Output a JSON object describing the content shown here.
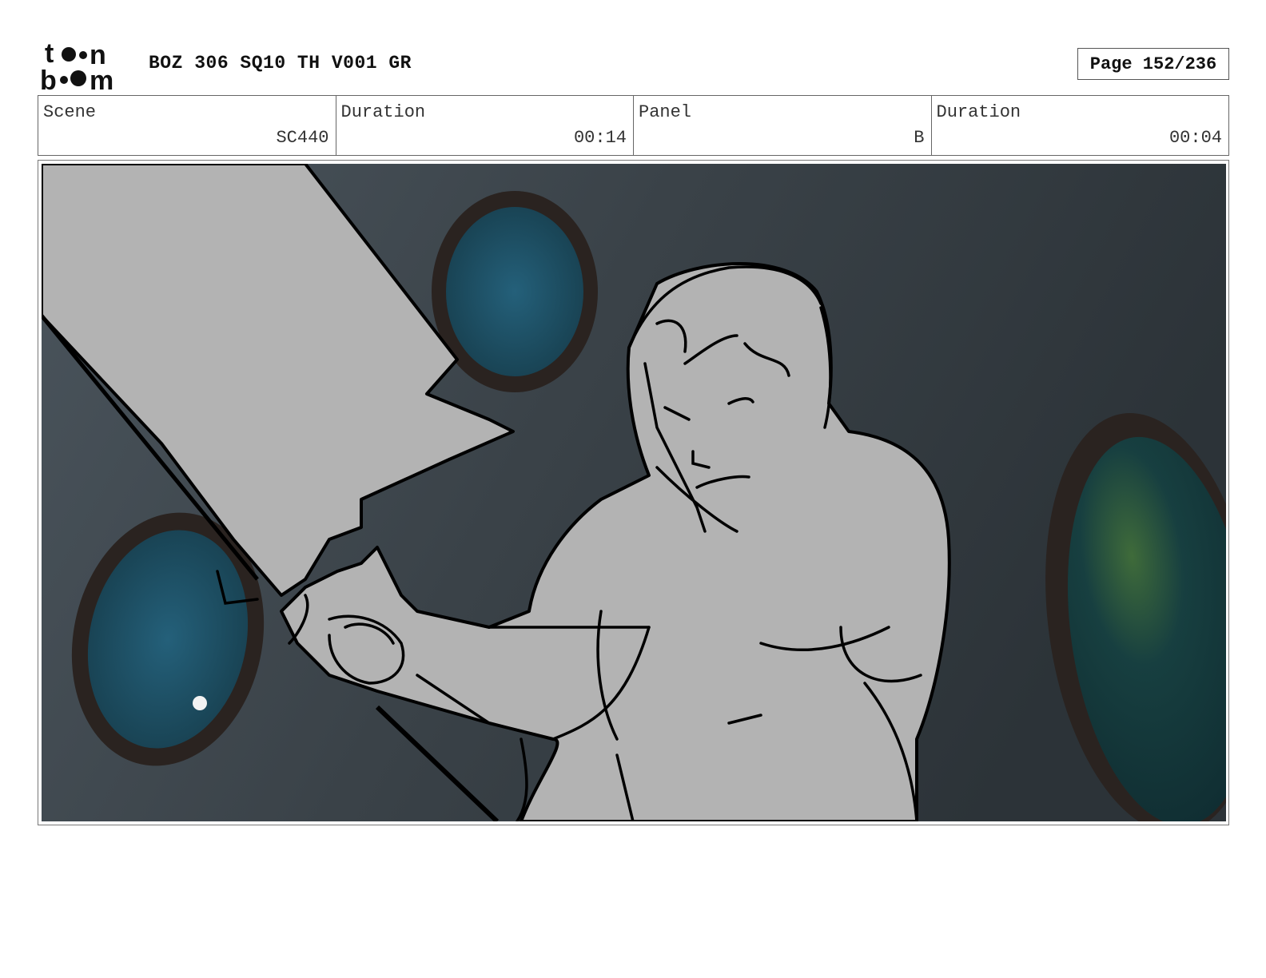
{
  "header": {
    "logo_text": "toon boom",
    "title": "BOZ 306 SQ10 TH V001 GR",
    "page": "Page 152/236"
  },
  "info": [
    {
      "label": "Scene",
      "value": "SC440"
    },
    {
      "label": "Duration",
      "value": "00:14"
    },
    {
      "label": "Panel",
      "value": "B"
    },
    {
      "label": "Duration",
      "value": "00:04"
    }
  ],
  "panel": {
    "description_colors": {
      "wall": "#3a4045",
      "porthole_rim": "#2b2422",
      "porthole_glass": "#1f4f5f",
      "sketch_fill": "#b3b3b3",
      "ink": "#000000"
    }
  }
}
